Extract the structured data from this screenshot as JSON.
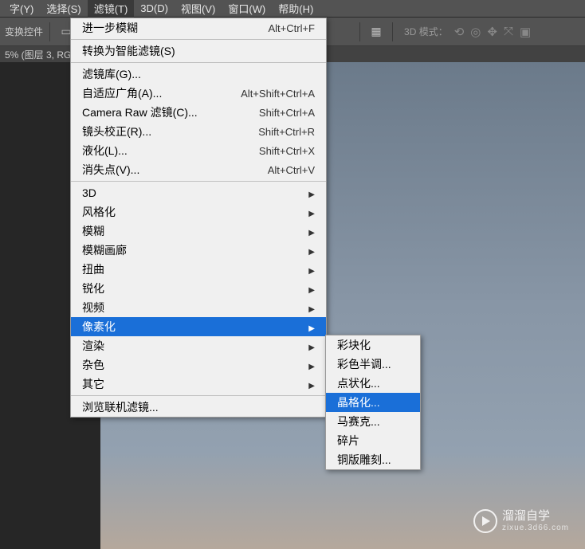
{
  "menubar": {
    "items": [
      "字(Y)",
      "选择(S)",
      "滤镜(T)",
      "3D(D)",
      "视图(V)",
      "窗口(W)",
      "帮助(H)"
    ],
    "active_index": 2
  },
  "toolbar": {
    "transform_label": "变换控件",
    "mode3d_label": "3D 模式："
  },
  "status": {
    "text": "5% (图层 3, RG"
  },
  "dropdown": {
    "recent": {
      "label": "进一步模糊",
      "shortcut": "Alt+Ctrl+F"
    },
    "smart": {
      "label": "转换为智能滤镜(S)"
    },
    "group1": [
      {
        "label": "滤镜库(G)...",
        "shortcut": ""
      },
      {
        "label": "自适应广角(A)...",
        "shortcut": "Alt+Shift+Ctrl+A"
      },
      {
        "label": "Camera Raw 滤镜(C)...",
        "shortcut": "Shift+Ctrl+A"
      },
      {
        "label": "镜头校正(R)...",
        "shortcut": "Shift+Ctrl+R"
      },
      {
        "label": "液化(L)...",
        "shortcut": "Shift+Ctrl+X"
      },
      {
        "label": "消失点(V)...",
        "shortcut": "Alt+Ctrl+V"
      }
    ],
    "group2": [
      {
        "label": "3D",
        "sub": true
      },
      {
        "label": "风格化",
        "sub": true
      },
      {
        "label": "模糊",
        "sub": true
      },
      {
        "label": "模糊画廊",
        "sub": true
      },
      {
        "label": "扭曲",
        "sub": true
      },
      {
        "label": "锐化",
        "sub": true
      },
      {
        "label": "视频",
        "sub": true
      },
      {
        "label": "像素化",
        "sub": true,
        "hover": true
      },
      {
        "label": "渲染",
        "sub": true
      },
      {
        "label": "杂色",
        "sub": true
      },
      {
        "label": "其它",
        "sub": true
      }
    ],
    "browse": {
      "label": "浏览联机滤镜..."
    }
  },
  "submenu": {
    "items": [
      {
        "label": "彩块化"
      },
      {
        "label": "彩色半调..."
      },
      {
        "label": "点状化..."
      },
      {
        "label": "晶格化...",
        "hover": true
      },
      {
        "label": "马赛克..."
      },
      {
        "label": "碎片"
      },
      {
        "label": "铜版雕刻..."
      }
    ]
  },
  "watermark": {
    "brand": "溜溜自学",
    "url": "zixue.3d66.com"
  }
}
